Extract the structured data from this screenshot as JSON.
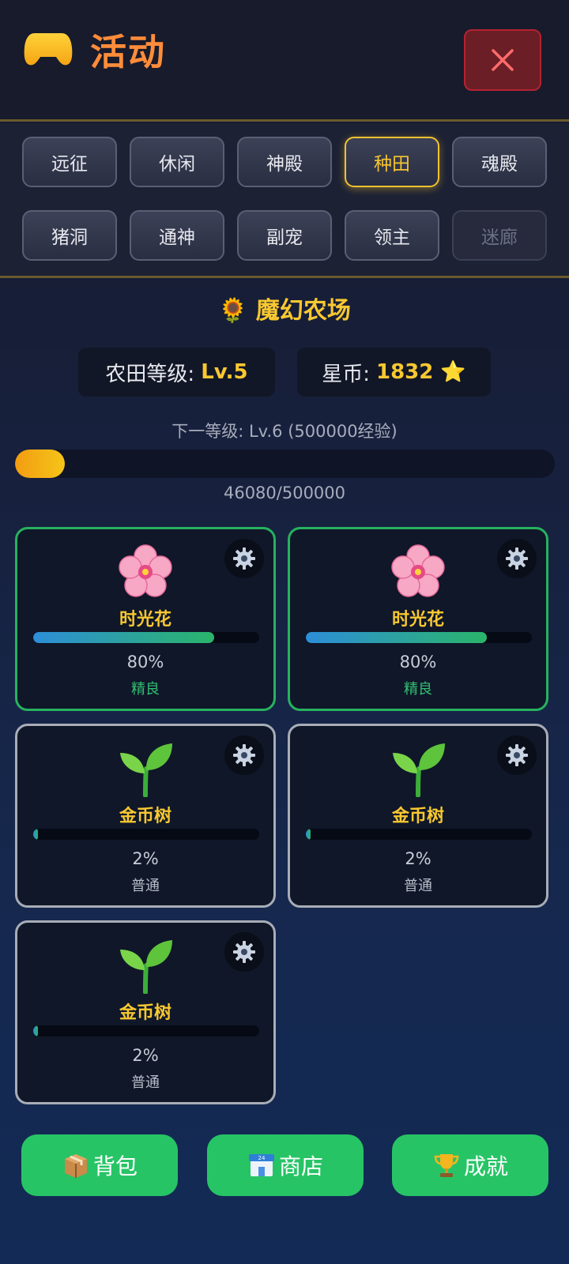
{
  "header": {
    "title": "活动",
    "icon": "gamepad-icon",
    "close_icon": "close-icon"
  },
  "tabs": [
    {
      "label": "远征",
      "state": "normal"
    },
    {
      "label": "休闲",
      "state": "normal"
    },
    {
      "label": "神殿",
      "state": "normal"
    },
    {
      "label": "种田",
      "state": "active"
    },
    {
      "label": "魂殿",
      "state": "normal"
    },
    {
      "label": "猪洞",
      "state": "normal"
    },
    {
      "label": "通神",
      "state": "normal"
    },
    {
      "label": "副宠",
      "state": "normal"
    },
    {
      "label": "领主",
      "state": "normal"
    },
    {
      "label": "迷廊",
      "state": "disabled"
    }
  ],
  "farm": {
    "title": "🌻 魔幻农场",
    "level_label": "农田等级:",
    "level_value": "Lv.5",
    "coin_label": "星币:",
    "coin_value": "1832 ⭐",
    "next_level": "下一等级: Lv.6 (500000经验)",
    "xp_text": "46080/500000",
    "xp_fraction": 0.09216
  },
  "plots": [
    {
      "name": "时光花",
      "icon": "blossom-icon",
      "percent_text": "80%",
      "progress": 0.8,
      "quality": "精良"
    },
    {
      "name": "时光花",
      "icon": "blossom-icon",
      "percent_text": "80%",
      "progress": 0.8,
      "quality": "精良"
    },
    {
      "name": "金币树",
      "icon": "seedling-icon",
      "percent_text": "2%",
      "progress": 0.02,
      "quality": "普通"
    },
    {
      "name": "金币树",
      "icon": "seedling-icon",
      "percent_text": "2%",
      "progress": 0.02,
      "quality": "普通"
    },
    {
      "name": "金币树",
      "icon": "seedling-icon",
      "percent_text": "2%",
      "progress": 0.02,
      "quality": "普通"
    }
  ],
  "bottom_buttons": [
    {
      "label": "背包",
      "icon": "package-icon"
    },
    {
      "label": "商店",
      "icon": "store-icon"
    },
    {
      "label": "成就",
      "icon": "trophy-icon"
    }
  ],
  "colors": {
    "accent": "#f8c830",
    "good": "#27b25e",
    "button": "#27c466",
    "close": "#b42230"
  }
}
